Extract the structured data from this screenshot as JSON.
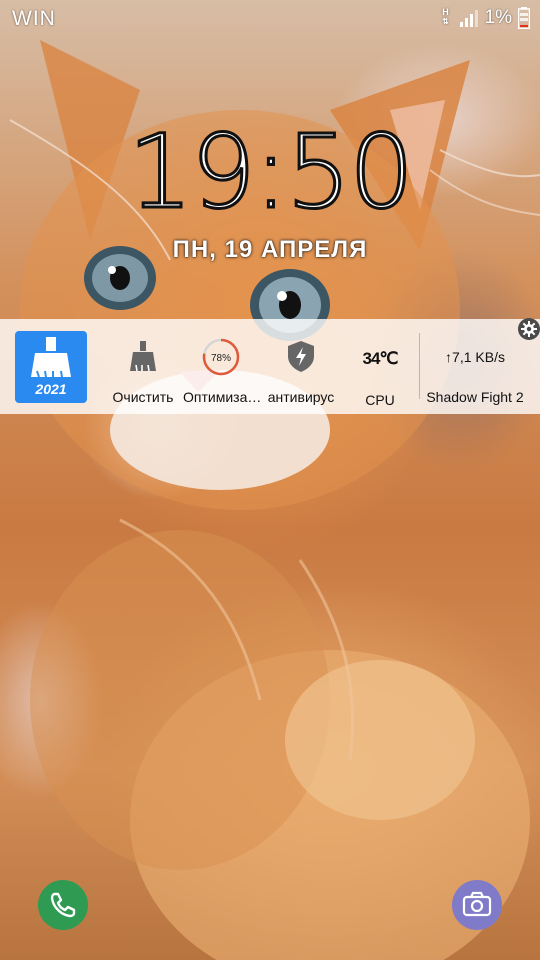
{
  "status_bar": {
    "carrier": "WIN",
    "network_type": "H",
    "battery_percent": "1%",
    "icons": [
      "network-type-icon",
      "signal-icon",
      "battery-icon"
    ]
  },
  "lock_screen": {
    "time": "19:50",
    "date": "ПН, 19 АПРЕЛЯ"
  },
  "widget": {
    "app_tile_year": "2021",
    "clean_label": "Очистить",
    "optimize_percent": "78%",
    "optimize_level": 0.78,
    "optimize_label": "Оптимиза…",
    "antivirus_label": "антивирус",
    "cpu_temp": "34℃",
    "cpu_label": "CPU",
    "net_speed": "↑7,1 KB/s",
    "running_app": "Shadow Fight 2",
    "accent_color": "#2a8af0",
    "gauge_color": "#e05a3a"
  },
  "shortcuts": {
    "left": "phone-icon",
    "right": "camera-icon"
  }
}
